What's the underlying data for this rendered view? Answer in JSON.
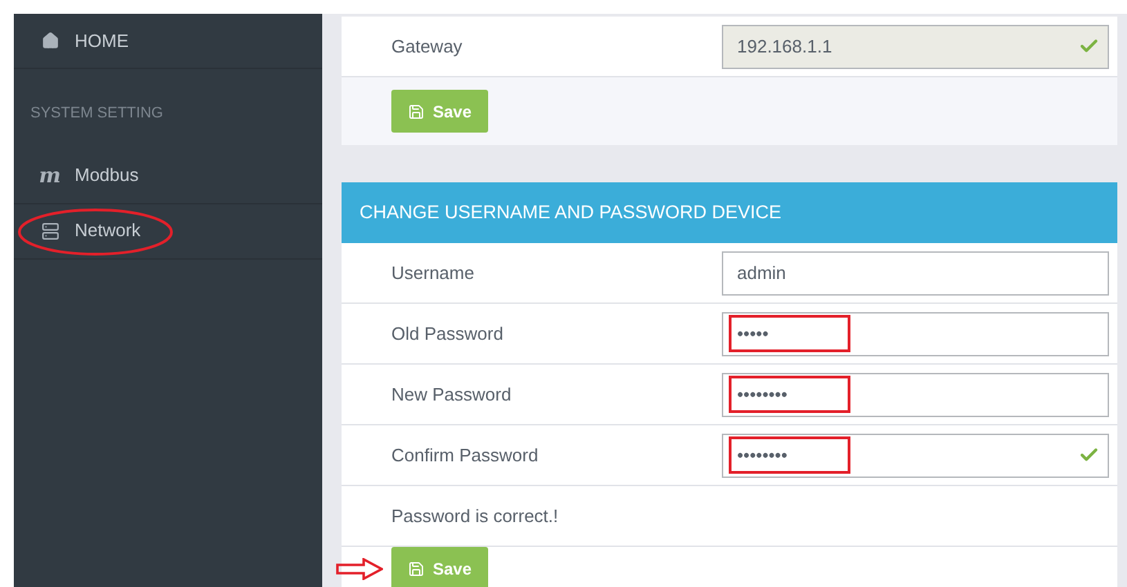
{
  "sidebar": {
    "items": [
      {
        "kind": "link",
        "label": "HOME",
        "annotated": false
      },
      {
        "kind": "heading",
        "label": "SYSTEM SETTING"
      },
      {
        "kind": "link",
        "icon_text": "m",
        "label": "Modbus",
        "annotated": false
      },
      {
        "kind": "link",
        "label": "Network",
        "annotated": true
      }
    ]
  },
  "network_card": {
    "fields": [
      {
        "label": "Gateway",
        "value": "192.168.1.1",
        "disabled": true,
        "valid": true
      }
    ],
    "save_button": {
      "label": "Save",
      "annotated": false
    }
  },
  "account_card": {
    "title": "CHANGE USERNAME AND PASSWORD DEVICE",
    "fields": [
      {
        "label": "Username",
        "value": "admin",
        "disabled": false,
        "valid": false,
        "annotated": false
      },
      {
        "label": "Old Password",
        "value": "•••••",
        "disabled": false,
        "valid": false,
        "annotated": true
      },
      {
        "label": "New Password",
        "value": "••••••••",
        "disabled": false,
        "valid": false,
        "annotated": true
      },
      {
        "label": "Confirm Password",
        "value": "••••••••",
        "disabled": false,
        "valid": true,
        "annotated": true
      }
    ],
    "message": "Password is correct.!",
    "save_button": {
      "label": "Save",
      "annotated": true
    }
  }
}
